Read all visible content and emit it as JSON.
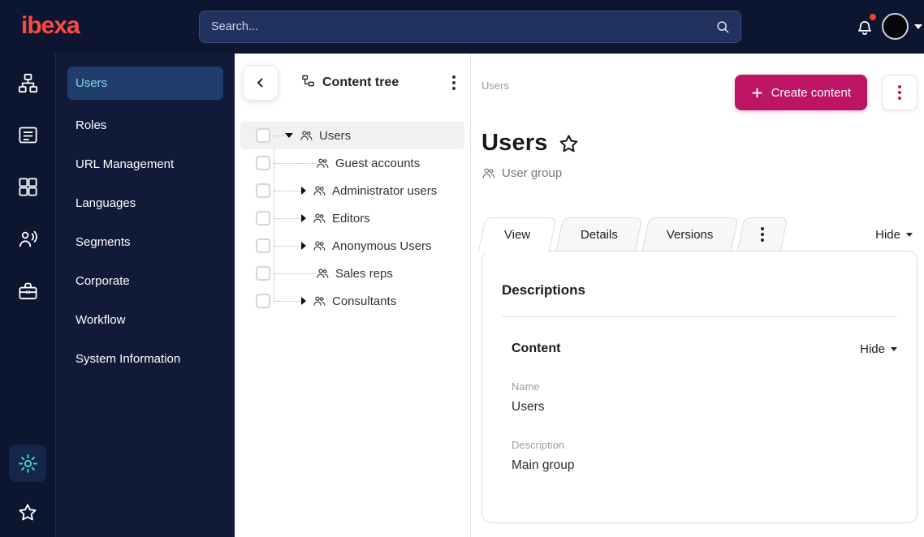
{
  "topbar": {
    "logo_text": "ibexa",
    "search": {
      "placeholder": "Search..."
    },
    "notification": {
      "has_unread_dot": true
    }
  },
  "rail": {
    "icons": [
      "sitemap-icon",
      "content-list-icon",
      "modules-icon",
      "segments-person-icon",
      "toolbox-icon"
    ],
    "bottom_icons": [
      {
        "name": "settings-gear-icon",
        "active": true
      },
      {
        "name": "bookmarks-star-icon",
        "active": false
      }
    ]
  },
  "sidebar": {
    "items": [
      {
        "label": "Users",
        "active": true
      },
      {
        "label": "Roles",
        "active": false
      },
      {
        "label": "URL Management",
        "active": false
      },
      {
        "label": "Languages",
        "active": false
      },
      {
        "label": "Segments",
        "active": false
      },
      {
        "label": "Corporate",
        "active": false
      },
      {
        "label": "Workflow",
        "active": false
      },
      {
        "label": "System Information",
        "active": false
      }
    ]
  },
  "tree": {
    "title": "Content tree",
    "items": [
      {
        "label": "Users",
        "level": 0,
        "caret": "down",
        "selected": true
      },
      {
        "label": "Guest accounts",
        "level": 1,
        "caret": "none",
        "selected": false
      },
      {
        "label": "Administrator users",
        "level": 1,
        "caret": "right",
        "selected": false
      },
      {
        "label": "Editors",
        "level": 1,
        "caret": "right",
        "selected": false
      },
      {
        "label": "Anonymous Users",
        "level": 1,
        "caret": "right",
        "selected": false
      },
      {
        "label": "Sales reps",
        "level": 1,
        "caret": "none",
        "selected": false
      },
      {
        "label": "Consultants",
        "level": 1,
        "caret": "right",
        "selected": false
      }
    ]
  },
  "main": {
    "breadcrumb": "Users",
    "create_button_label": "Create content",
    "title": "Users",
    "content_type": "User group",
    "tabs": [
      {
        "label": "View",
        "active": true
      },
      {
        "label": "Details",
        "active": false
      },
      {
        "label": "Versions",
        "active": false
      }
    ],
    "hide_label": "Hide",
    "card": {
      "heading": "Descriptions",
      "section_title": "Content",
      "section_hide_label": "Hide",
      "fields": [
        {
          "label": "Name",
          "value": "Users"
        },
        {
          "label": "Description",
          "value": "Main group"
        }
      ]
    }
  },
  "colors": {
    "brand_logo_red": "#ff4a42",
    "primary_action_magenta": "#bd1464",
    "topbar_navy": "#0d1631",
    "sidebar_navy": "#111a38",
    "active_menu_blue": "#1f3d6d",
    "accent_teal": "#3fd6c4",
    "notification_red": "#f43f2e"
  }
}
